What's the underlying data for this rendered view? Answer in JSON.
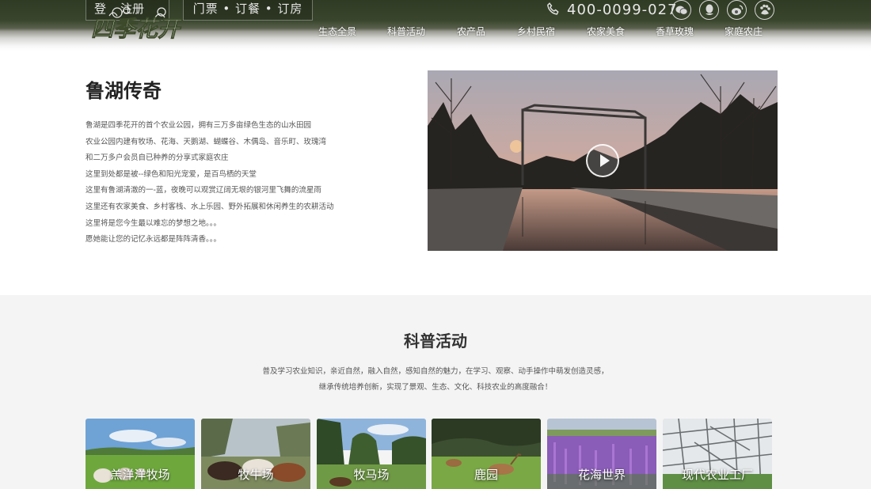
{
  "header": {
    "login_label": "登",
    "register_label": "注册",
    "booking_label": "门票 • 订餐 • 订房",
    "logo_text": "四季花开",
    "phone": "400-0099-027",
    "social_icons": [
      "wechat-icon",
      "qq-icon",
      "weibo-icon",
      "baidu-icon"
    ],
    "nav": [
      "生态全景",
      "科普活动",
      "农产品",
      "乡村民宿",
      "农家美食",
      "香草玫瑰",
      "家庭农庄"
    ]
  },
  "legend": {
    "title": "鲁湖传奇",
    "lines": [
      "鲁湖是四季花开的首个农业公园，拥有三万多亩绿色生态的山水田园",
      "农业公园内建有牧场、花海、天鹅湖、蝴蝶谷、木偶岛、音乐町、玫瑰湾",
      "和二万多户会员自已种养的分享式家庭农庄",
      "这里到处都是被--绿色和阳光宠爱，是百鸟栖的天堂",
      "这里有鲁湖清澈的一-蓝，夜晚可以观赏辽阔无垠的银河里飞舞的流星雨",
      "这里还有农家美食、乡村客栈、水上乐园、野外拓展和休闲养生的农耕活动",
      "这里将是您今生最以难忘的梦想之地。。。",
      "愿她能让您的记忆永远都是阵阵清香。。。"
    ]
  },
  "science": {
    "title": "科普活动",
    "desc_line1": "普及学习农业知识，亲近自然，融入自然，感知自然的魅力，在学习、观察、动手操作中萌发创造灵感，",
    "desc_line2": "继承传统培养创新，实现了景观、生态、文化、科技农业的高度融合！",
    "cards": [
      {
        "label": "羔洋洋牧场"
      },
      {
        "label": "牧牛场"
      },
      {
        "label": "牧马场"
      },
      {
        "label": "鹿园"
      },
      {
        "label": "花海世界"
      },
      {
        "label": "现代农业工厂"
      }
    ]
  }
}
